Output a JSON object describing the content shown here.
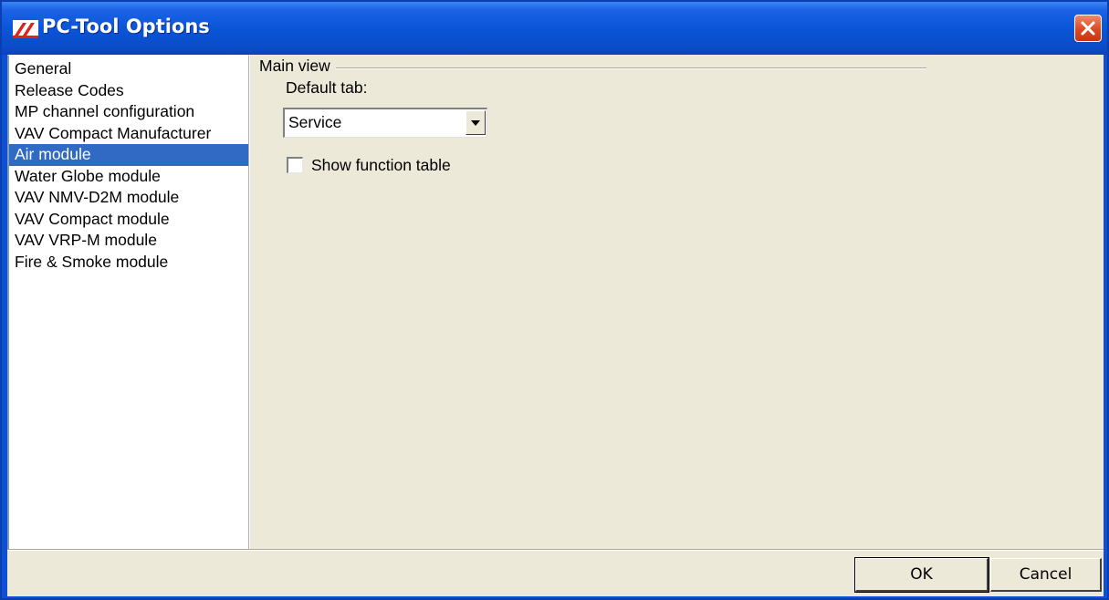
{
  "window": {
    "title": "PC-Tool Options"
  },
  "sidebar": {
    "items": [
      {
        "label": "General"
      },
      {
        "label": "Release Codes"
      },
      {
        "label": "MP channel configuration"
      },
      {
        "label": "VAV Compact Manufacturer"
      },
      {
        "label": "Air module",
        "selected": true
      },
      {
        "label": "Water Globe module"
      },
      {
        "label": "VAV NMV-D2M module"
      },
      {
        "label": "VAV Compact module"
      },
      {
        "label": "VAV VRP-M module"
      },
      {
        "label": "Fire & Smoke module"
      }
    ]
  },
  "main": {
    "group_title": "Main view",
    "default_tab_label": "Default tab:",
    "default_tab_value": "Service",
    "show_function_table_label": "Show function table",
    "show_function_table_checked": false
  },
  "footer": {
    "ok_label": "OK",
    "cancel_label": "Cancel"
  },
  "colors": {
    "titlebar": "#0a55d8",
    "selection": "#316ac5",
    "dialog_bg": "#ece9d8",
    "close_button": "#d94a24"
  },
  "icons": {
    "app": "pc-tool-logo-icon",
    "close": "close-icon",
    "dropdown": "chevron-down-icon"
  }
}
